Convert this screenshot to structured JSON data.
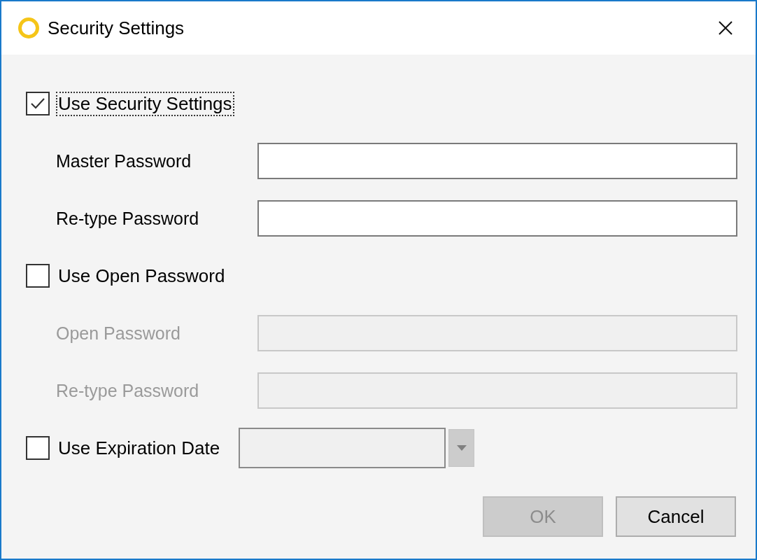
{
  "window": {
    "title": "Security Settings"
  },
  "options": [
    {
      "kind": "checkbox",
      "label": "Use Security Settings",
      "checked": true,
      "focused": true
    },
    {
      "kind": "field",
      "label": "Master Password",
      "disabled": false
    },
    {
      "kind": "field",
      "label": "Re-type Password",
      "disabled": false
    },
    {
      "kind": "checkbox",
      "label": "Use Open Password",
      "checked": false,
      "focused": false
    },
    {
      "kind": "field",
      "label": "Open Password",
      "disabled": true
    },
    {
      "kind": "field",
      "label": "Re-type Password",
      "disabled": true
    },
    {
      "kind": "date",
      "label": "Use Expiration Date",
      "checked": false,
      "disabled": true
    }
  ],
  "buttons": [
    {
      "label": "OK",
      "disabled": true
    },
    {
      "label": "Cancel",
      "disabled": false
    }
  ]
}
